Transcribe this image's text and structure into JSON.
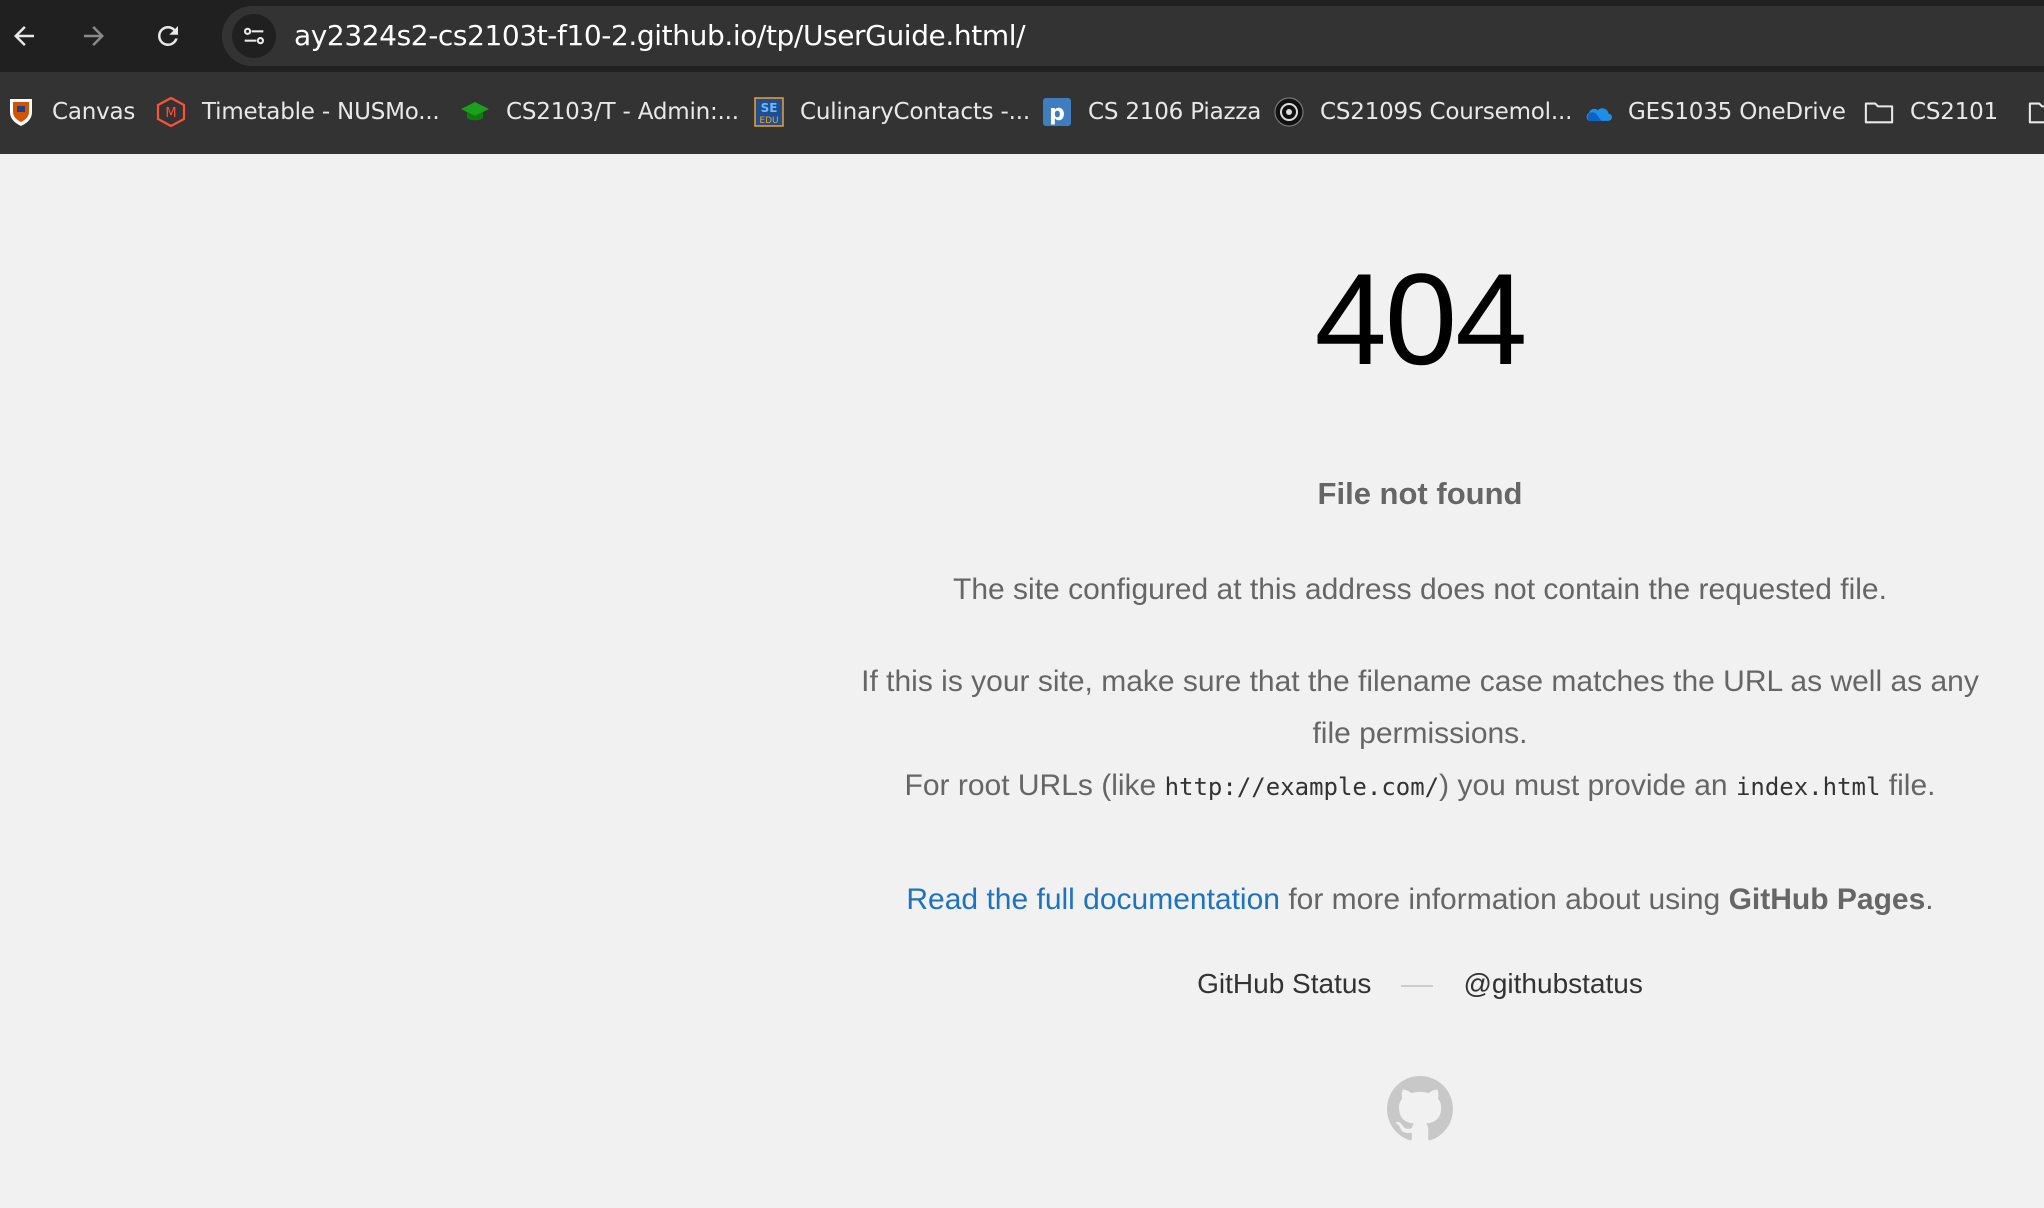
{
  "browser": {
    "url": "ay2324s2-cs2103t-f10-2.github.io/tp/UserGuide.html/",
    "nav_icons": [
      "back-arrow-icon",
      "forward-arrow-icon",
      "reload-icon",
      "site-info-icon"
    ],
    "bookmarks": [
      {
        "label": "Canvas",
        "icon": "canvas-crest-icon"
      },
      {
        "label": "Timetable - NUSMo...",
        "icon": "nusmods-icon"
      },
      {
        "label": "CS2103/T - Admin:...",
        "icon": "graduation-cap-icon"
      },
      {
        "label": "CulinaryContacts -...",
        "icon": "se-edu-icon"
      },
      {
        "label": "CS 2106 Piazza",
        "icon": "piazza-icon"
      },
      {
        "label": "CS2109S Coursemol...",
        "icon": "coursemology-icon"
      },
      {
        "label": "GES1035 OneDrive",
        "icon": "onedrive-cloud-icon"
      },
      {
        "label": "CS2101",
        "icon": "folder-icon"
      }
    ],
    "se_icon_text": {
      "top": "SE",
      "bottom": "EDU"
    },
    "piazza_icon_text": "p",
    "nusmods_icon_text": "M"
  },
  "page": {
    "code": "404",
    "headline": "File not found",
    "para1": "The site configured at this address does not contain the requested file.",
    "para2": {
      "line1": "If this is your site, make sure that the filename case matches the URL as well as any",
      "line2": "file permissions.",
      "line3_pre": "For root URLs (like ",
      "line3_code1": "http://example.com/",
      "line3_mid": ") you must provide an ",
      "line3_code2": "index.html",
      "line3_post": " file."
    },
    "para3": {
      "link": "Read the full documentation",
      "mid": " for more information about using ",
      "strong": "GitHub Pages",
      "post": "."
    },
    "footer": {
      "status": "GitHub Status",
      "twitter": "@githubstatus"
    },
    "logo_icon": "github-octocat-icon"
  },
  "colors": {
    "page_bg": "#f1f1f1",
    "text_gray": "#666666",
    "link_blue": "#1e73be",
    "chrome_dark": "#202020",
    "bookmarks_bar": "#333333"
  }
}
